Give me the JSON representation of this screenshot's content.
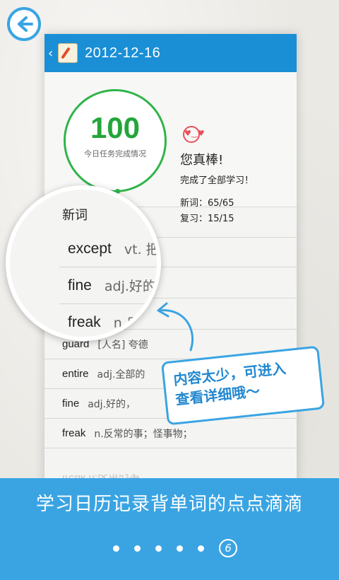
{
  "header": {
    "date": "2012-12-16",
    "back_icon": "chevron-left-icon"
  },
  "summary": {
    "score": "100",
    "score_label": "今日任务完成情况",
    "praise_title": "您真棒!",
    "praise_sub": "完成了全部学习！",
    "new_words": "新词：65/65",
    "review": "复习：15/15"
  },
  "magnifier": {
    "heading": "新词",
    "rows": [
      {
        "word": "except",
        "meaning": "vt. 把…除外；不计；"
      },
      {
        "word": "fine",
        "meaning": "adj.好的；等的；怪整个事物…"
      },
      {
        "word": "freak",
        "meaning": "n.反常的事；怪事物；"
      }
    ]
  },
  "list": {
    "rows": [
      {
        "word": "guard",
        "meaning": "[人名] 夸德"
      },
      {
        "word": "entire",
        "meaning": "adj.全部的"
      },
      {
        "word": "fine",
        "meaning": "adj.好的，"
      },
      {
        "word": "freak",
        "meaning": "n.反常的事；怪事物；"
      }
    ],
    "reflection": "freak  n.反常的事"
  },
  "callout": {
    "line1": "内容太少，可进入",
    "line2": "查看详细哦～"
  },
  "banner": {
    "title": "学习日历记录背单词的点点滴滴",
    "page": "6"
  },
  "colors": {
    "accent": "#3aa4e3",
    "titlebar": "#1a8fd6",
    "score": "#23a63a"
  }
}
